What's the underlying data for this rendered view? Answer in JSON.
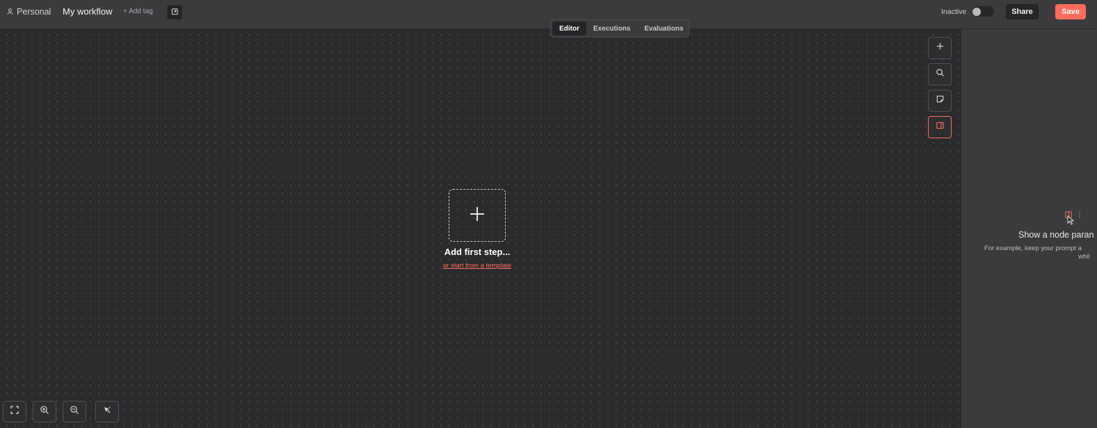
{
  "header": {
    "project": "Personal",
    "workflow_name": "My workflow",
    "add_tag": "+ Add tag",
    "status_label": "Inactive",
    "share_label": "Share",
    "save_label": "Save"
  },
  "tabs": [
    {
      "label": "Editor",
      "active": true
    },
    {
      "label": "Executions",
      "active": false
    },
    {
      "label": "Evaluations",
      "active": false
    }
  ],
  "canvas": {
    "add_first_step": "Add first step...",
    "template_link": "or start from a template",
    "right_toolbar": [
      "plus-icon",
      "search-icon",
      "sticky-note-icon",
      "panel-toggle-icon"
    ],
    "bottom_toolbar": [
      "fit-view-icon",
      "zoom-in-icon",
      "zoom-out-icon",
      "tidy-up-icon"
    ]
  },
  "right_panel": {
    "title": "Show a node paran",
    "description_line1": "For example, keep your prompt a",
    "description_line2": "whil"
  },
  "colors": {
    "accent": "#ff6d5a",
    "topbar": "#3b3b3e",
    "canvas": "#2b2b2d"
  }
}
